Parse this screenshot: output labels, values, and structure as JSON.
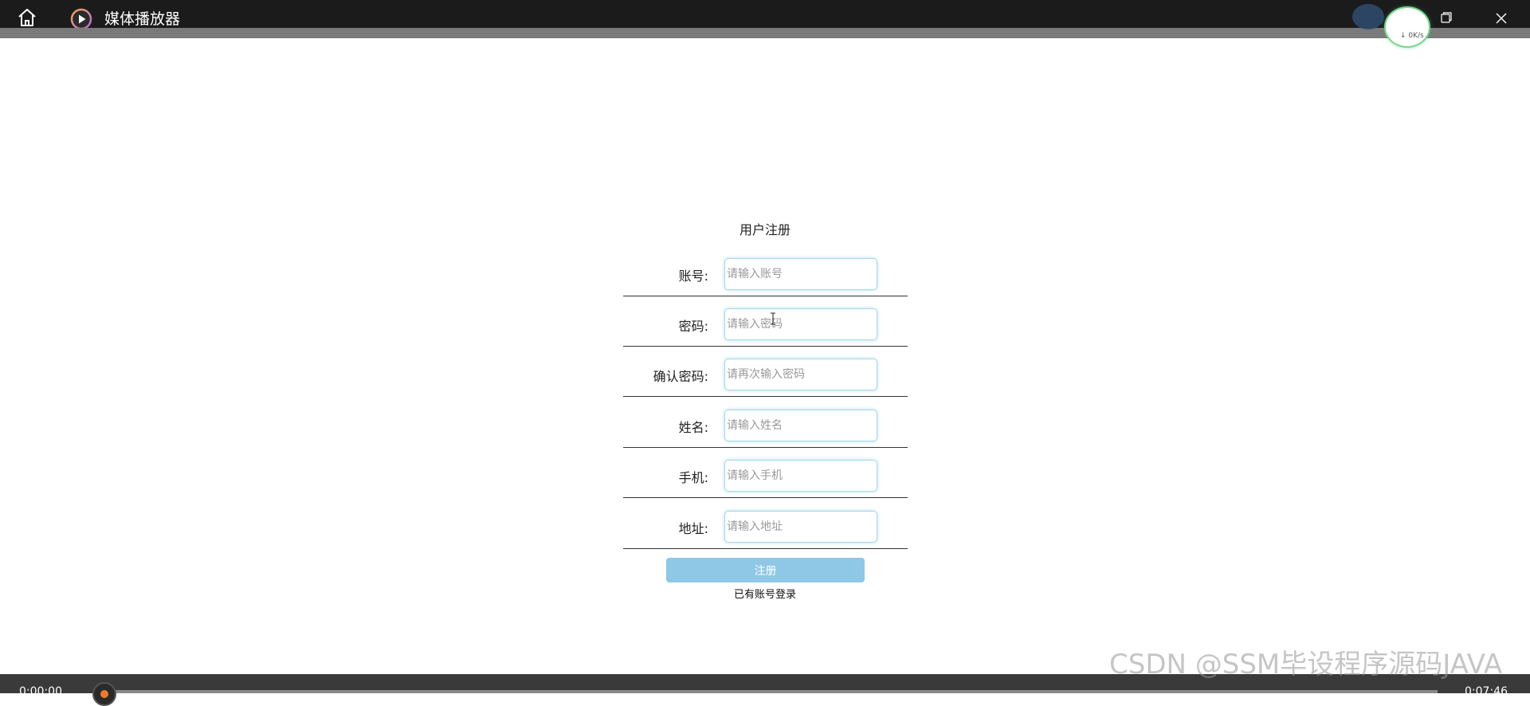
{
  "titlebar": {
    "title": "媒体播放器",
    "home_icon": "home-icon",
    "app_icon": "play-circle-icon",
    "minimize_icon": "minimize-icon",
    "maximize_icon": "restore-icon",
    "close_icon": "close-icon"
  },
  "network_widget": {
    "speed": "↓ 0K/s"
  },
  "form": {
    "title": "用户注册",
    "fields": [
      {
        "label": "账号:",
        "placeholder": "请输入账号"
      },
      {
        "label": "密码:",
        "placeholder": "请输入密码"
      },
      {
        "label": "确认密码:",
        "placeholder": "请再次输入密码"
      },
      {
        "label": "姓名:",
        "placeholder": "请输入姓名"
      },
      {
        "label": "手机:",
        "placeholder": "请输入手机"
      },
      {
        "label": "地址:",
        "placeholder": "请输入地址"
      }
    ],
    "submit_label": "注册",
    "login_link": "已有账号登录"
  },
  "player": {
    "current_time": "0:00:00",
    "total_time": "0:07:46",
    "progress": 0
  },
  "watermark": "CSDN @SSM毕设程序源码JAVA",
  "colors": {
    "titlebar_bg": "#1b1b1b",
    "accent_button": "#8fc8e7",
    "input_border": "#a6d8e6",
    "seek_thumb": "#f07a2a",
    "speed_ring": "#74d88a"
  }
}
